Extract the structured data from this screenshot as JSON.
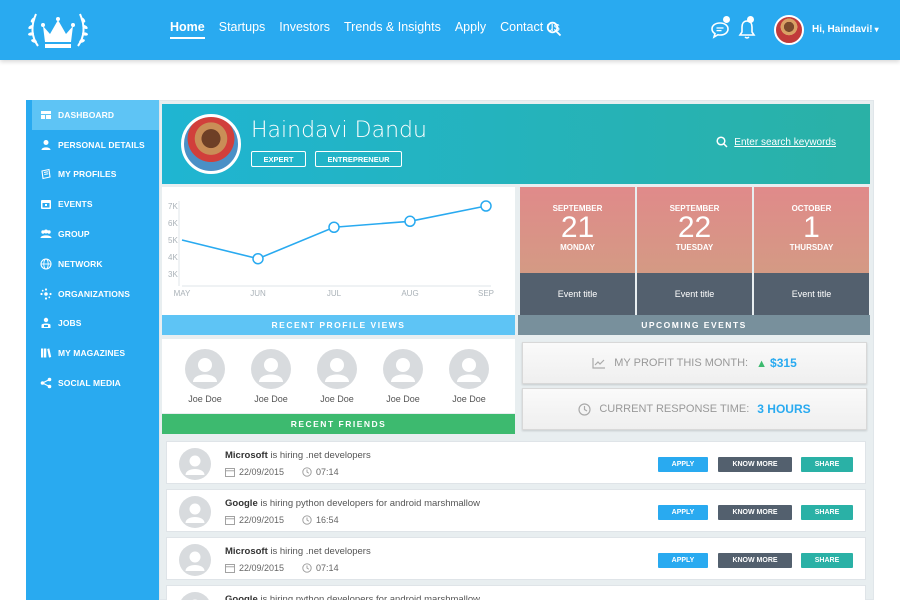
{
  "header": {
    "nav": [
      "Home",
      "Startups",
      "Investors",
      "Trends & Insights",
      "Apply",
      "Contact us"
    ],
    "active_nav": "Home",
    "greeting": "Hi, Haindavi!"
  },
  "sidebar": {
    "items": [
      {
        "label": "Dashboard",
        "icon": "dashboard-icon"
      },
      {
        "label": "Personal Details",
        "icon": "user-icon"
      },
      {
        "label": "My Profiles",
        "icon": "profiles-icon"
      },
      {
        "label": "Events",
        "icon": "calendar-icon"
      },
      {
        "label": "Group",
        "icon": "group-icon"
      },
      {
        "label": "Network",
        "icon": "globe-icon"
      },
      {
        "label": "Organizations",
        "icon": "organizations-icon"
      },
      {
        "label": "Jobs",
        "icon": "jobs-icon"
      },
      {
        "label": "My Magazines",
        "icon": "magazines-icon"
      },
      {
        "label": "Social Media",
        "icon": "share-icon"
      }
    ]
  },
  "profile": {
    "name": "Haindavi Dandu",
    "tags": [
      "EXPERT",
      "ENTREPRENEUR"
    ],
    "search_placeholder": "Enter search keywords"
  },
  "chart_data": {
    "type": "line",
    "categories": [
      "MAY",
      "JUN",
      "JUL",
      "AUG",
      "SEP"
    ],
    "values": [
      5000,
      3900,
      5750,
      6100,
      7000
    ],
    "yticks": [
      "7K",
      "6K",
      "5K",
      "4K",
      "3K"
    ],
    "ylim": [
      3000,
      7000
    ],
    "color": "#29aaf0",
    "title": "RECENT PROFILE VIEWS"
  },
  "recent_profile_views_label": "RECENT PROFILE VIEWS",
  "events": {
    "label": "UPCOMING EVENTS",
    "items": [
      {
        "month": "SEPTEMBER",
        "day": "21",
        "weekday": "MONDAY",
        "title": "Event title"
      },
      {
        "month": "SEPTEMBER",
        "day": "22",
        "weekday": "TUESDAY",
        "title": "Event title"
      },
      {
        "month": "OCTOBER",
        "day": "1",
        "weekday": "THURSDAY",
        "title": "Event title"
      }
    ]
  },
  "friends": {
    "label": "RECENT FRIENDS",
    "names": [
      "Joe Doe",
      "Joe Doe",
      "Joe Doe",
      "Joe Doe",
      "Joe Doe"
    ]
  },
  "stats": {
    "profit_label": "MY PROFIT THIS MONTH:",
    "profit_value": "$315",
    "response_label": "CURRENT RESPONSE TIME:",
    "response_value": "3 HOURS"
  },
  "jobs": [
    {
      "company": "Microsoft",
      "text": "is hiring .net developers",
      "date": "22/09/2015",
      "time": "07:14"
    },
    {
      "company": "Google",
      "text": "is hiring python developers for android marshmallow",
      "date": "22/09/2015",
      "time": "16:54"
    },
    {
      "company": "Microsoft",
      "text": "is hiring .net developers",
      "date": "22/09/2015",
      "time": "07:14"
    },
    {
      "company": "Google",
      "text": "is hiring python developers for android marshmallow",
      "date": "",
      "time": ""
    }
  ],
  "job_buttons": {
    "apply": "APPLY",
    "know_more": "KNOW MORE",
    "share": "SHARE"
  },
  "colors": {
    "brand": "#29aaf0",
    "teal": "#2ab1a6",
    "green": "#3dba6f",
    "slate": "#53606e"
  }
}
